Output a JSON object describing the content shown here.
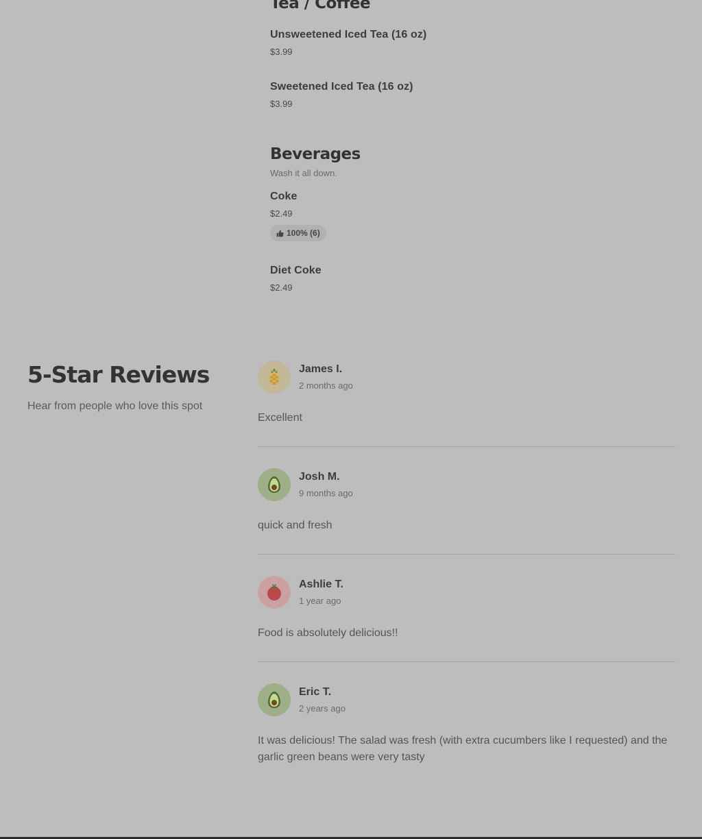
{
  "menu": {
    "tea_section": {
      "title": "Tea / Coffee",
      "items": [
        {
          "name": "Unsweetened Iced Tea (16 oz)",
          "price": "$3.99"
        },
        {
          "name": "Sweetened Iced Tea (16 oz)",
          "price": "$3.99"
        }
      ]
    },
    "beverages_section": {
      "title": "Beverages",
      "subtitle": "Wash it all down.",
      "items": [
        {
          "name": "Coke",
          "price": "$2.49",
          "rating": "100% (6)",
          "rating_icon": "thumbs-up-icon"
        },
        {
          "name": "Diet Coke",
          "price": "$2.49"
        }
      ]
    }
  },
  "reviews": {
    "title": "5-Star Reviews",
    "subtitle": "Hear from people who love this spot",
    "items": [
      {
        "name": "James I.",
        "time": "2 months ago",
        "text": "Excellent",
        "avatar": "pineapple-icon",
        "avatar_bg": "#c3b896"
      },
      {
        "name": "Josh M.",
        "time": "9 months ago",
        "text": "quick and fresh",
        "avatar": "avocado-icon",
        "avatar_bg": "#9eae86"
      },
      {
        "name": "Ashlie T.",
        "time": "1 year ago",
        "text": "Food is absolutely delicious!!",
        "avatar": "tomato-icon",
        "avatar_bg": "#c9a1a1"
      },
      {
        "name": "Eric T.",
        "time": "2 years ago",
        "text": "It was delicious! The salad was fresh (with extra cucumbers like I requested) and the garlic green beans were very tasty",
        "avatar": "avocado-icon",
        "avatar_bg": "#9eae86"
      }
    ]
  }
}
